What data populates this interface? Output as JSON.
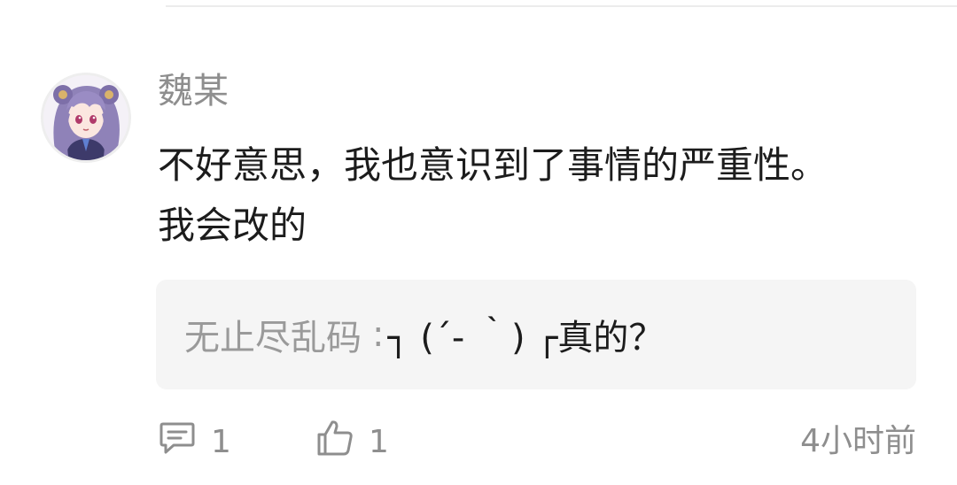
{
  "comment": {
    "username": "魏某",
    "text": "不好意思，我也意识到了事情的严重性。我会改的",
    "reply": {
      "author": "无止尽乱码",
      "separator": ":",
      "text": "┐ (´- ｀) ┌真的？"
    },
    "reply_count": "1",
    "like_count": "1",
    "time": "4小时前"
  },
  "icons": {
    "reply": "comment-bubble-icon",
    "like": "thumbs-up-icon"
  },
  "colors": {
    "username": "#8e8e8e",
    "text": "#1c1c1c",
    "reply_bg": "#f5f5f5",
    "meta": "#8e8e8e"
  }
}
